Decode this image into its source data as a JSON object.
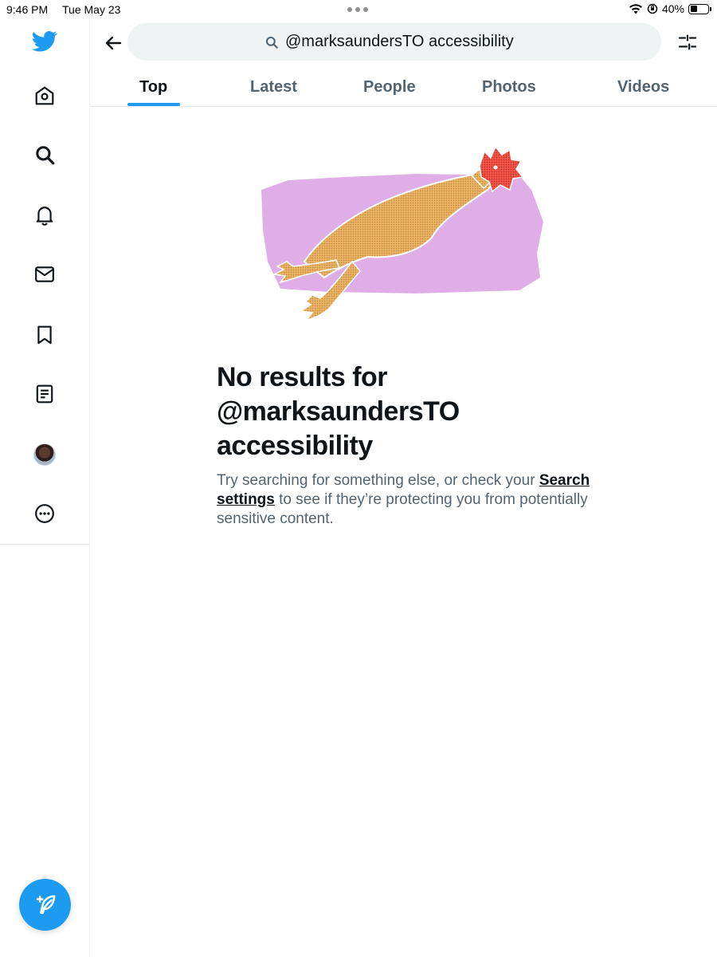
{
  "status_bar": {
    "time": "9:46 PM",
    "date": "Tue May 23",
    "battery": "40%",
    "battery_level": 0.4
  },
  "sidebar": {
    "items": [
      {
        "name": "twitter-logo",
        "icon": "bird-icon"
      },
      {
        "name": "home",
        "icon": "home-icon"
      },
      {
        "name": "explore",
        "icon": "search-icon"
      },
      {
        "name": "notifications",
        "icon": "bell-icon"
      },
      {
        "name": "messages",
        "icon": "envelope-icon"
      },
      {
        "name": "bookmarks",
        "icon": "bookmark-icon"
      },
      {
        "name": "lists",
        "icon": "list-icon"
      },
      {
        "name": "profile",
        "icon": "avatar"
      },
      {
        "name": "more",
        "icon": "more-icon"
      }
    ],
    "compose_icon": "feather-plus-icon"
  },
  "header": {
    "search_value": "@marksaundersTO accessibility",
    "back_icon": "arrow-left-icon",
    "filter_icon": "sliders-icon"
  },
  "tabs": [
    {
      "label": "Top",
      "active": true
    },
    {
      "label": "Latest"
    },
    {
      "label": "People"
    },
    {
      "label": "Photos"
    },
    {
      "label": "Videos"
    }
  ],
  "empty_state": {
    "title": "No results for @marksaundersTO accessibility",
    "body_before": "Try searching for something else, or check your ",
    "link_text": "Search settings",
    "body_after": " to see if they’re protecting you from potentially sensitive content."
  },
  "colors": {
    "accent": "#1d9bf0",
    "illustration_bg": "#e0aee6",
    "secondary_text": "#536471"
  }
}
